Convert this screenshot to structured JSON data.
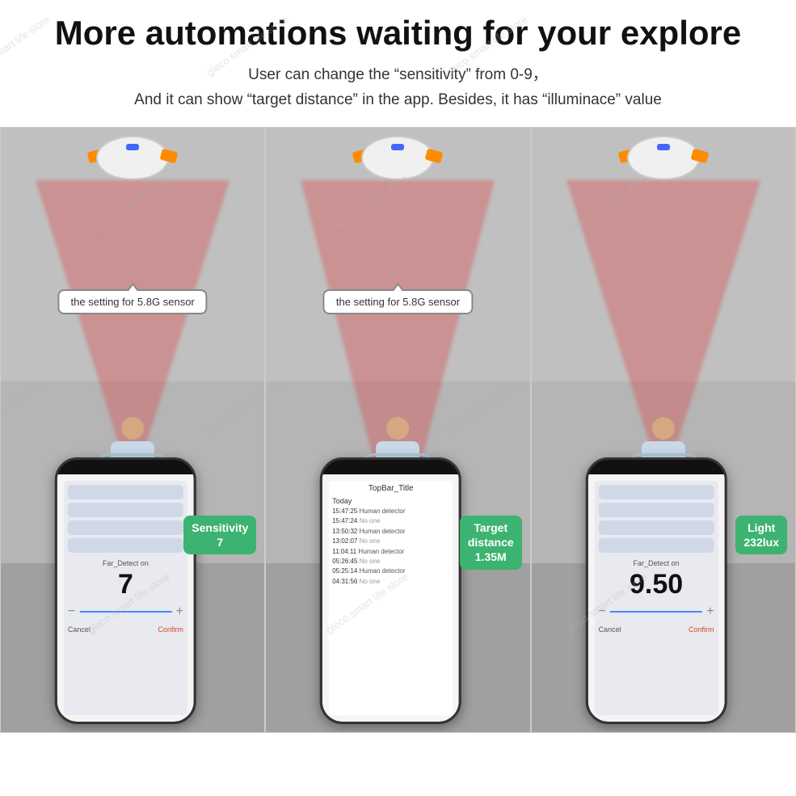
{
  "page": {
    "title": "More automations waiting for your explore",
    "subtitle_line1": "User can change the  “sensitivity”  from 0-9，",
    "subtitle_line2": "And it can show  “target distance”  in the app. Besides, it has  “illuminace”  value"
  },
  "watermark": "gleco smart life store",
  "panels": [
    {
      "id": "panel-1",
      "tooltip": "the setting for 5.8G sensor",
      "badge_label": "Sensitivity\n7",
      "badge_color": "#3cb370",
      "phone": {
        "type": "sensitivity",
        "detect_label": "Far_Detect on",
        "big_number": "7",
        "cancel": "Cancel",
        "confirm": "Confirm"
      }
    },
    {
      "id": "panel-2",
      "tooltip": "the setting for 5.8G sensor",
      "badge_label": "Target\ndistance\n1.35M",
      "badge_color": "#3cb370",
      "phone": {
        "type": "log",
        "topbar": "TopBar_Title",
        "date": "Today",
        "entries": [
          {
            "time": "15:47:25",
            "event": "Human detector"
          },
          {
            "time": "15:47:24",
            "event": "No one"
          },
          {
            "time": "13:50:32",
            "event": "Human detector"
          },
          {
            "time": "13:02:07",
            "event": "No one"
          },
          {
            "time": "11:04:11",
            "event": "Human detector"
          },
          {
            "time": "05:26:45",
            "event": "No one"
          },
          {
            "time": "05:25:14",
            "event": "Human detector"
          },
          {
            "time": "04:31:56",
            "event": "No one"
          }
        ]
      }
    },
    {
      "id": "panel-3",
      "tooltip": null,
      "badge_label": "Light\n232lux",
      "badge_color": "#3cb370",
      "phone": {
        "type": "light",
        "detect_label": "Far_Detect on",
        "big_number": "9.50",
        "cancel": "Cancel",
        "confirm": "Confirm"
      }
    }
  ]
}
